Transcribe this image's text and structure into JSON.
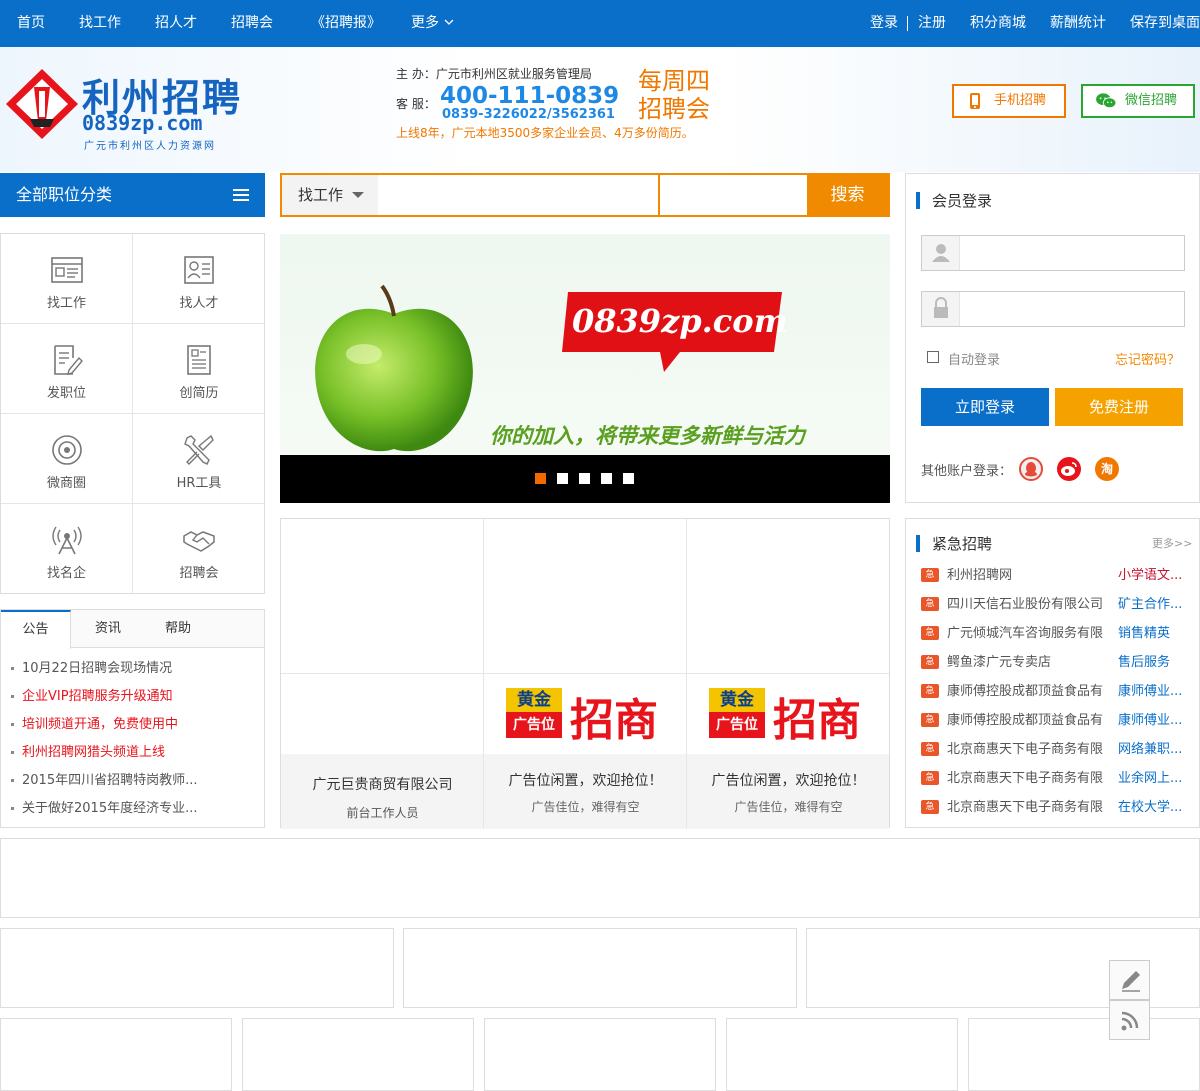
{
  "topnav": {
    "left": [
      "首页",
      "找工作",
      "招人才",
      "招聘会",
      "《招聘报》",
      "更多"
    ],
    "login": "登录",
    "register": "注册",
    "right": [
      "积分商城",
      "薪酬统计",
      "保存到桌面"
    ]
  },
  "header": {
    "logo_main": "利州招聘",
    "logo_domain": "0839zp.com",
    "logo_sub": "广元市利州区人力资源网",
    "sponsor": "主  办：广元市利州区就业服务管理局",
    "service_label": "客  服：",
    "hotline": "400-111-0839",
    "phones": "0839-3226022/3562361",
    "slogan": "上线8年，广元本地3500多家企业会员、4万多份简历。",
    "week_line1": "每周四",
    "week_line2": "招聘会",
    "mobile_btn": "手机招聘",
    "wechat_btn": "微信招聘"
  },
  "colors": {
    "primary": "#0a6fc9",
    "accent": "#f08a00",
    "mobile": "#f07800",
    "wechat": "#2aa530"
  },
  "categories": {
    "title": "全部职位分类",
    "items": [
      {
        "label": "找工作",
        "icon": "job-list-icon"
      },
      {
        "label": "找人才",
        "icon": "resume-card-icon"
      },
      {
        "label": "发职位",
        "icon": "edit-document-icon"
      },
      {
        "label": "创简历",
        "icon": "document-icon"
      },
      {
        "label": "微商圈",
        "icon": "target-icon"
      },
      {
        "label": "HR工具",
        "icon": "tools-icon"
      },
      {
        "label": "找名企",
        "icon": "antenna-icon"
      },
      {
        "label": "招聘会",
        "icon": "handshake-icon"
      }
    ]
  },
  "news": {
    "tabs": [
      "公告",
      "资讯",
      "帮助"
    ],
    "items": [
      {
        "text": "10月22日招聘会现场情况",
        "hot": false
      },
      {
        "text": "企业VIP招聘服务升级通知",
        "hot": true
      },
      {
        "text": "培训频道开通，免费使用中",
        "hot": true
      },
      {
        "text": "利州招聘网猎头频道上线",
        "hot": true
      },
      {
        "text": "2015年四川省招聘特岗教师...",
        "hot": false
      },
      {
        "text": "关于做好2015年度经济专业...",
        "hot": false
      }
    ]
  },
  "search": {
    "type": "找工作",
    "button": "搜索",
    "keyword": "",
    "location": ""
  },
  "banner": {
    "domain": "0839zp.com",
    "slogan": "你的加入，将带来更多新鲜与活力",
    "slides": 5,
    "active_slide": 1
  },
  "ads": {
    "company_name": "广元巨贵商贸有限公司",
    "company_job": "前台工作人员",
    "badge_top": "黄金",
    "badge_bottom": "广告位",
    "badge_main": "招商",
    "vacant_title": "广告位闲置，欢迎抢位！",
    "vacant_sub": "广告佳位，难得有空"
  },
  "login": {
    "title": "会员登录",
    "username": "",
    "password": "",
    "auto_login": "自动登录",
    "forgot": "忘记密码？",
    "login_btn": "立即登录",
    "register_btn": "免费注册",
    "other": "其他账户登录："
  },
  "urgent": {
    "title": "紧急招聘",
    "more": "更多>>",
    "tag": "急",
    "rows": [
      {
        "company": "利州招聘网",
        "job": "小学语文...",
        "job_color": "#c8102e"
      },
      {
        "company": "四川天信石业股份有限公司",
        "job": "矿主合作...",
        "job_color": "#0a6fc9"
      },
      {
        "company": "广元倾城汽车咨询服务有限",
        "job": "销售精英",
        "job_color": "#0a6fc9"
      },
      {
        "company": "鳄鱼漆广元专卖店",
        "job": "售后服务",
        "job_color": "#0a6fc9"
      },
      {
        "company": "康师傅控股成都顶益食品有",
        "job": "康师傅业...",
        "job_color": "#0a6fc9"
      },
      {
        "company": "康师傅控股成都顶益食品有",
        "job": "康师傅业...",
        "job_color": "#0a6fc9"
      },
      {
        "company": "北京商惠天下电子商务有限",
        "job": "网络兼职...",
        "job_color": "#0a6fc9"
      },
      {
        "company": "北京商惠天下电子商务有限",
        "job": "业余网上...",
        "job_color": "#0a6fc9"
      },
      {
        "company": "北京商惠天下电子商务有限",
        "job": "在校大学...",
        "job_color": "#0a6fc9"
      }
    ]
  }
}
